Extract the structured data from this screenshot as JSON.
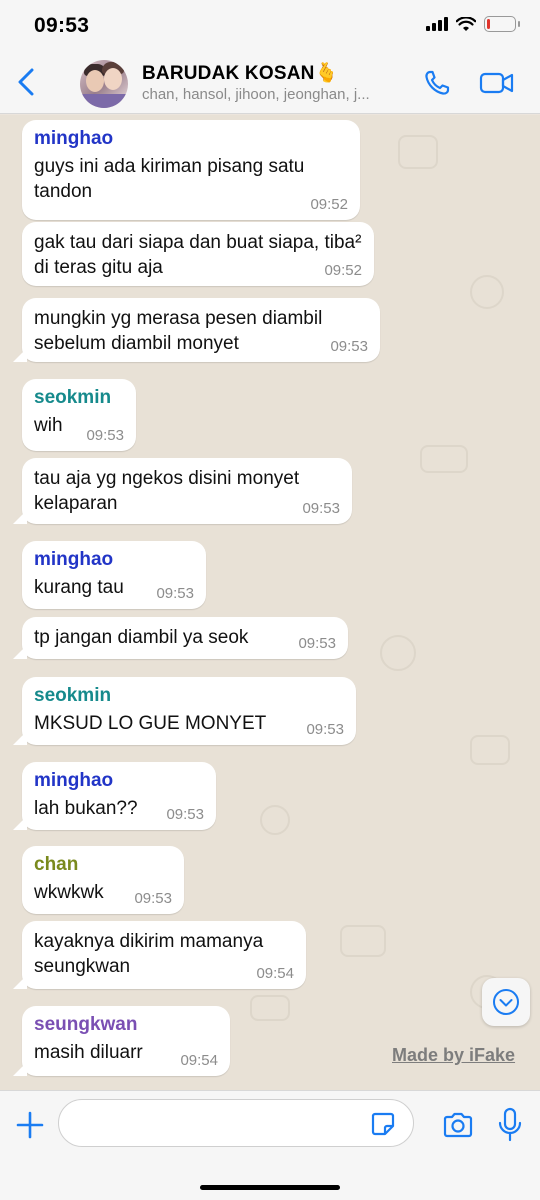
{
  "status_bar": {
    "time": "09:53",
    "battery_level": 0.12,
    "battery_color": "#e0342d"
  },
  "header": {
    "group_name": "BARUDAK KOSAN🫰",
    "members": "chan, hansol, jihoon, jeonghan, j...",
    "accent": "#1a7cf2"
  },
  "messages": [
    {
      "sender": "minghao",
      "sender_color": "#2235c7",
      "text": "guys ini ada kiriman pisang satu tandon",
      "time": "09:52"
    },
    {
      "sender": "",
      "text": "gak tau dari siapa dan buat siapa, tiba² di teras gitu aja",
      "time": "09:52"
    },
    {
      "sender": "",
      "text": "mungkin yg merasa pesen diambil sebelum diambil monyet",
      "time": "09:53"
    },
    {
      "sender": "seokmin",
      "sender_color": "#168a8c",
      "text": "wih",
      "time": "09:53"
    },
    {
      "sender": "",
      "text": "tau aja yg ngekos disini monyet kelaparan",
      "time": "09:53"
    },
    {
      "sender": "minghao",
      "sender_color": "#2235c7",
      "text": "kurang tau",
      "time": "09:53"
    },
    {
      "sender": "",
      "text": "tp jangan diambil ya seok",
      "time": "09:53"
    },
    {
      "sender": "seokmin",
      "sender_color": "#168a8c",
      "text": "MKSUD LO GUE MONYET",
      "time": "09:53"
    },
    {
      "sender": "minghao",
      "sender_color": "#2235c7",
      "text": "lah bukan??",
      "time": "09:53"
    },
    {
      "sender": "chan",
      "sender_color": "#7a8a1d",
      "text": "wkwkwk",
      "time": "09:53"
    },
    {
      "sender": "",
      "text": "kayaknya dikirim mamanya seungkwan",
      "time": "09:54"
    },
    {
      "sender": "seungkwan",
      "sender_color": "#7a4fb3",
      "text": "masih diluarr",
      "time": "09:54"
    }
  ],
  "watermark": "Made by iFake",
  "composer": {
    "placeholder": ""
  },
  "icons": [
    "back-icon",
    "phone-icon",
    "video-icon",
    "plus-icon",
    "sticker-icon",
    "camera-icon",
    "mic-icon",
    "chevron-down-icon"
  ]
}
